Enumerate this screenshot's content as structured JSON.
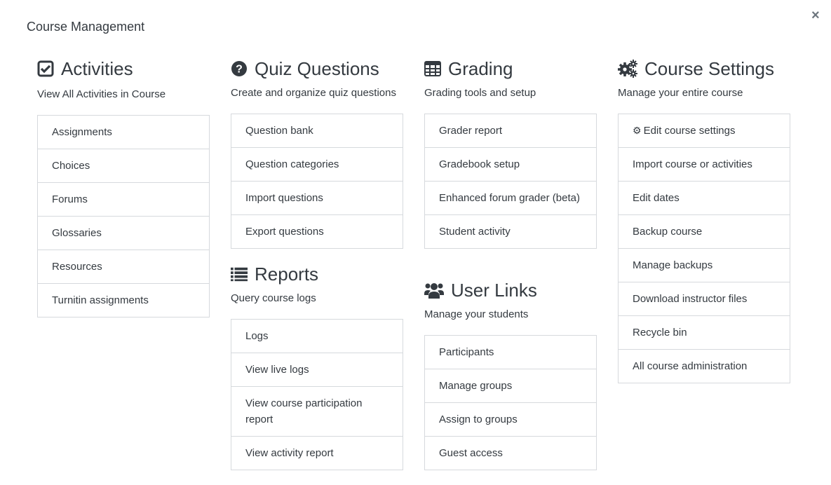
{
  "title": "Course Management",
  "close_label": "×",
  "sections": {
    "activities": {
      "title": "Activities",
      "icon": "check-square-icon",
      "description": "View All Activities in Course",
      "items": [
        "Assignments",
        "Choices",
        "Forums",
        "Glossaries",
        "Resources",
        "Turnitin assignments"
      ]
    },
    "quiz": {
      "title": "Quiz Questions",
      "icon": "question-circle-icon",
      "description": "Create and organize quiz questions",
      "items": [
        "Question bank",
        "Question categories",
        "Import questions",
        "Export questions"
      ]
    },
    "reports": {
      "title": "Reports",
      "icon": "list-icon",
      "description": "Query course logs",
      "items": [
        "Logs",
        "View live logs",
        "View course participation report",
        "View activity report"
      ]
    },
    "grading": {
      "title": "Grading",
      "icon": "table-icon",
      "description": "Grading tools and setup",
      "items": [
        "Grader report",
        "Gradebook setup",
        "Enhanced forum grader (beta)",
        "Student activity"
      ]
    },
    "users": {
      "title": "User Links",
      "icon": "users-icon",
      "description": "Manage your students",
      "items": [
        "Participants",
        "Manage groups",
        "Assign to groups",
        "Guest access"
      ]
    },
    "settings": {
      "title": "Course Settings",
      "icon": "cogs-icon",
      "description": "Manage your entire course",
      "items": [
        "Edit course settings",
        "Import course or activities",
        "Edit dates",
        "Backup course",
        "Manage backups",
        "Download instructor files",
        "Recycle bin",
        "All course administration"
      ]
    }
  }
}
